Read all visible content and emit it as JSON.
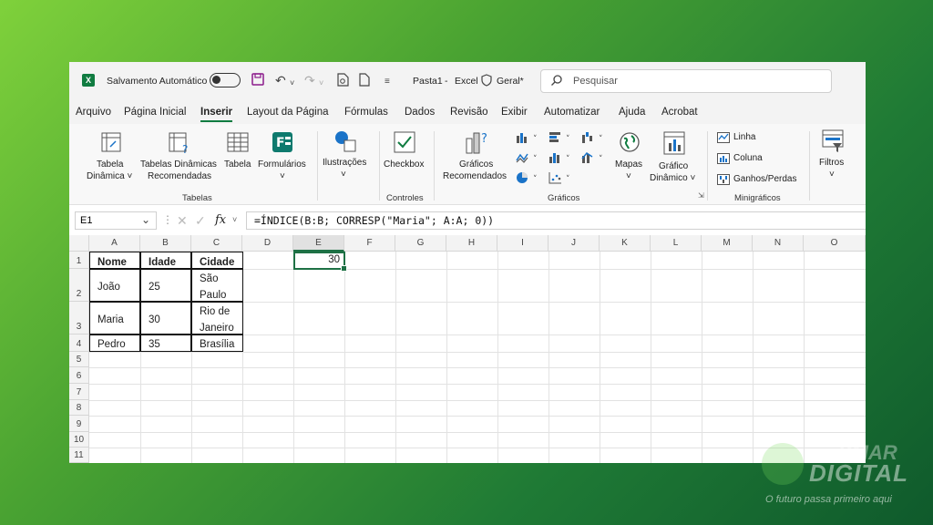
{
  "titlebar": {
    "autosave_label": "Salvamento Automático",
    "file_name": "Pasta1",
    "separator": "-",
    "app_name": "Excel",
    "sensitivity": "Geral*",
    "search_placeholder": "Pesquisar"
  },
  "menu": [
    "Arquivo",
    "Página Inicial",
    "Inserir",
    "Layout da Página",
    "Fórmulas",
    "Dados",
    "Revisão",
    "Exibir",
    "Automatizar",
    "Ajuda",
    "Acrobat"
  ],
  "active_menu": "Inserir",
  "ribbon": {
    "tabela_dinamica": [
      "Tabela",
      "Dinâmica ˅"
    ],
    "tabelas_recomendadas": [
      "Tabelas Dinâmicas",
      "Recomendadas"
    ],
    "tabela": "Tabela",
    "formularios": [
      "Formulários",
      "˅"
    ],
    "group_tabelas": "Tabelas",
    "ilustracoes": [
      "Ilustrações",
      "˅"
    ],
    "checkbox": "Checkbox",
    "group_controles": "Controles",
    "graficos_recomendados": [
      "Gráficos",
      "Recomendados"
    ],
    "mapas": [
      "Mapas",
      "˅"
    ],
    "grafico_dinamico": [
      "Gráfico",
      "Dinâmico ˅"
    ],
    "group_graficos": "Gráficos",
    "linha": "Linha",
    "coluna": "Coluna",
    "ganhos_perdas": "Ganhos/Perdas",
    "group_minigraficos": "Minigráficos",
    "filtros": [
      "Filtros",
      "˅"
    ]
  },
  "formula_bar": {
    "name_box": "E1",
    "fx": "fx",
    "formula": "=ÍNDICE(B:B; CORRESP(\"Maria\"; A:A; 0))"
  },
  "columns": [
    "A",
    "B",
    "C",
    "D",
    "E",
    "F",
    "G",
    "H",
    "I",
    "J",
    "K",
    "L",
    "M",
    "N",
    "O"
  ],
  "rows": [
    "1",
    "2",
    "3",
    "4",
    "5",
    "6",
    "7",
    "8",
    "9",
    "10",
    "11"
  ],
  "table": {
    "headers": [
      "Nome",
      "Idade",
      "Cidade"
    ],
    "rows": [
      {
        "nome": "João",
        "idade": "25",
        "cidade": [
          "São",
          "Paulo"
        ]
      },
      {
        "nome": "Maria",
        "idade": "30",
        "cidade": [
          "Rio de",
          "Janeiro"
        ]
      },
      {
        "nome": "Pedro",
        "idade": "35",
        "cidade": [
          "Brasília"
        ]
      }
    ]
  },
  "cell_e1": "30",
  "watermark": {
    "brand_top": "SMAR",
    "brand_bottom": "DIGITAL",
    "tagline": "O futuro passa primeiro aqui"
  },
  "colors": {
    "excel_green": "#107c41",
    "selection": "#1e7145"
  }
}
